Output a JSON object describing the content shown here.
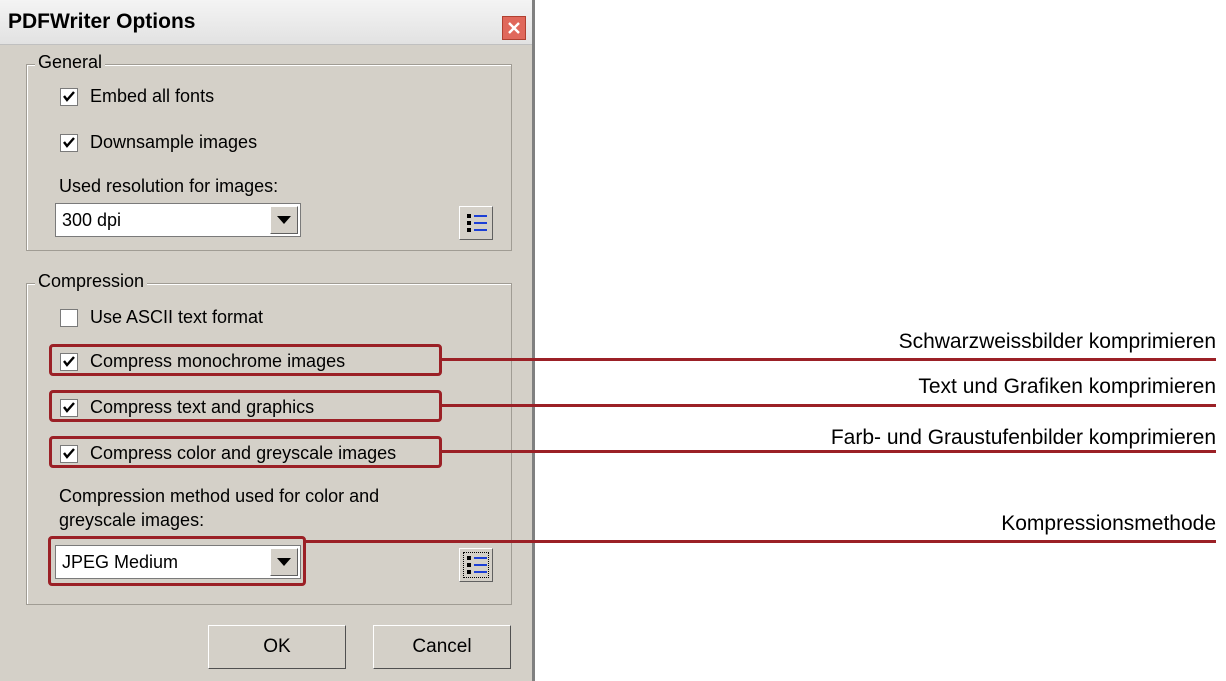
{
  "window": {
    "title": "PDFWriter Options"
  },
  "general": {
    "title": "General",
    "embed_fonts": {
      "label": "Embed all fonts",
      "checked": true
    },
    "downsample": {
      "label": "Downsample images",
      "checked": true
    },
    "resolution_label": "Used resolution for images:",
    "resolution_select": {
      "value": "300 dpi"
    }
  },
  "compression": {
    "title": "Compression",
    "ascii": {
      "label": "Use ASCII text format",
      "checked": false
    },
    "monochrome": {
      "label": "Compress monochrome images",
      "checked": true
    },
    "text_graphics": {
      "label": "Compress text and graphics",
      "checked": true
    },
    "color_grey": {
      "label": "Compress color and greyscale images",
      "checked": true
    },
    "method_label_line1": "Compression method used for color and",
    "method_label_line2": "greyscale images:",
    "method_select": {
      "value": "JPEG Medium"
    }
  },
  "buttons": {
    "ok": "OK",
    "cancel": "Cancel"
  },
  "annotations": {
    "monochrome": "Schwarzweissbilder komprimieren",
    "text_graphics": "Text und Grafiken komprimieren",
    "color_grey": "Farb- und Graustufenbilder komprimieren",
    "method": "Kompressionsmethode"
  },
  "colors": {
    "highlight": "#9b2026",
    "dialog_bg": "#d4d0c8"
  },
  "icons": [
    "close-icon",
    "checkmark-icon",
    "dropdown-arrow-icon",
    "list-settings-icon"
  ]
}
